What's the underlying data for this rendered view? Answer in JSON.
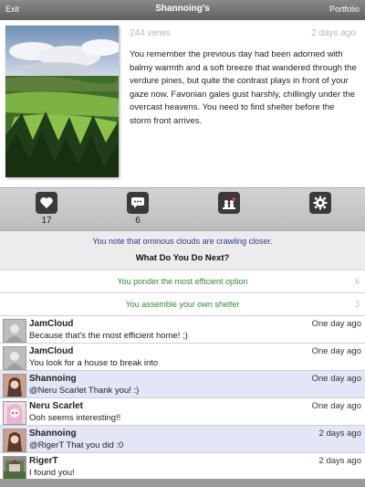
{
  "topbar": {
    "exit": "Exit",
    "title": "Shannoing's",
    "portfolio": "Portfolio"
  },
  "post": {
    "views": "244 views",
    "posted": "2 days ago",
    "story": "You remember the previous day had been adorned with balmy warmth and a soft breeze that wandered through the verdure pines, but quite the contrast plays in front of your gaze now. Favonian gales gust harshly, chillingly under the overcast heavens. You need to find shelter before the storm front arrives."
  },
  "actions": {
    "likes": "17",
    "comments": "6"
  },
  "choices": {
    "note": "You note that ominous clouds are crawling closer.",
    "question": "What Do You Do Next?",
    "options": [
      {
        "label": "You ponder the most efficient option",
        "count": "6"
      },
      {
        "label": "You assemble your own shelter",
        "count": "3"
      }
    ]
  },
  "comments": [
    {
      "user": "JamCloud",
      "time": "One day ago",
      "text": "Because that's the most efficient home! ;)"
    },
    {
      "user": "JamCloud",
      "time": "One day ago",
      "text": "You look for a house to break into"
    },
    {
      "user": "Shannoing",
      "time": "One day ago",
      "text": "@Neru Scarlet Thank you! :)"
    },
    {
      "user": "Neru Scarlet",
      "time": "One day ago",
      "text": "Ooh seems interesting!!"
    },
    {
      "user": "Shannoing",
      "time": "2 days ago",
      "text": "@RigerT That you did :0"
    },
    {
      "user": "RigerT",
      "time": "2 days ago",
      "text": "I found you!"
    }
  ],
  "colors": {
    "note": "#2b3a8f",
    "option": "#2f8a2f",
    "highlight_row": "#e3e6f6"
  },
  "icons": [
    "heart-icon",
    "comment-icon",
    "audience-icon",
    "gear-icon"
  ]
}
